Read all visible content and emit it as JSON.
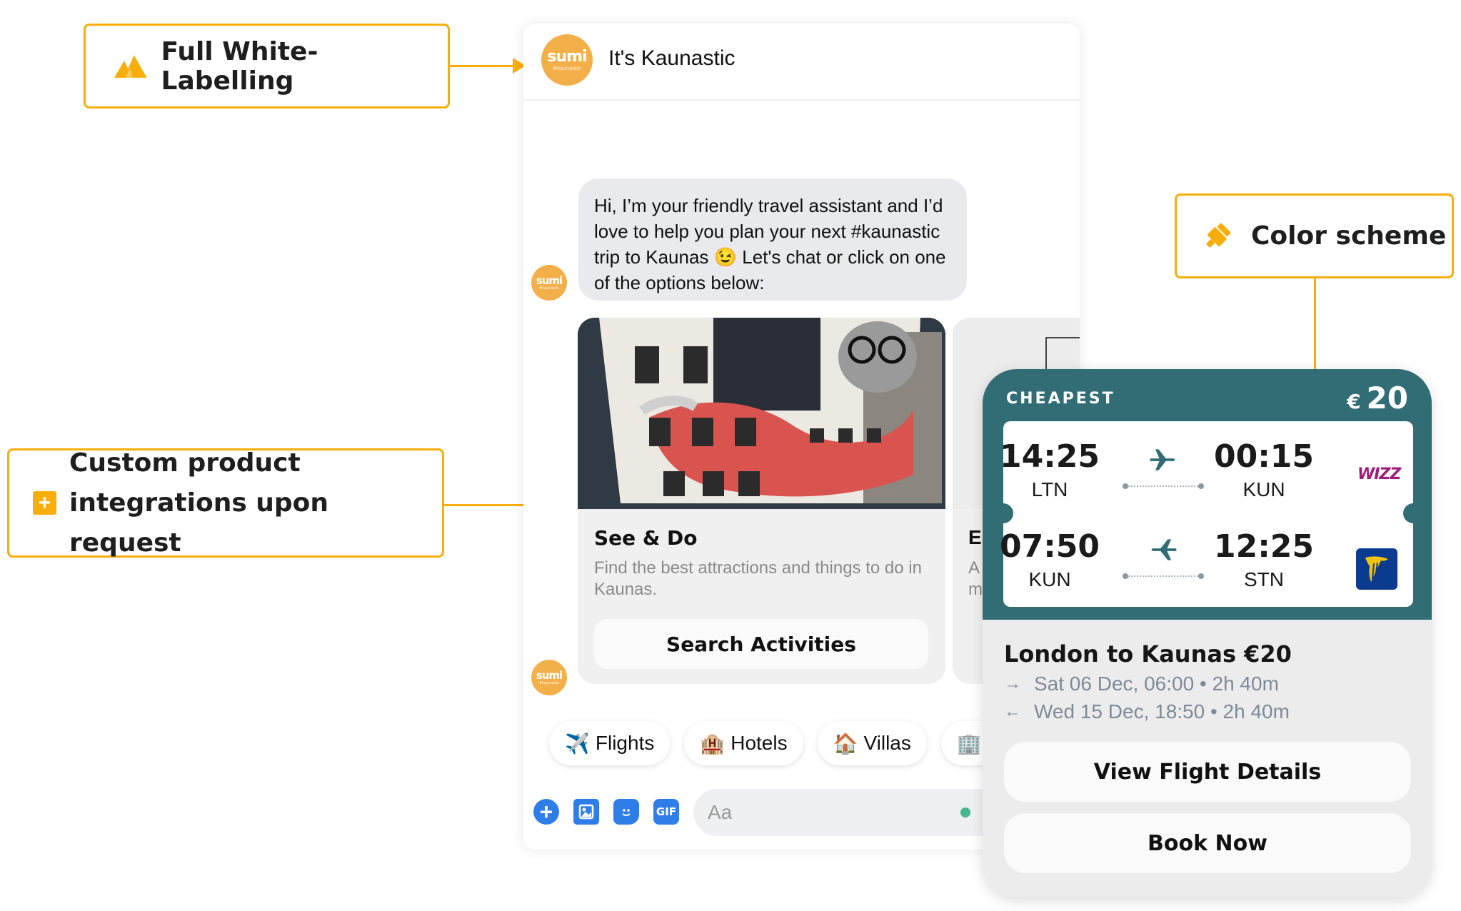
{
  "callouts": {
    "white_label": {
      "text": "Full White-Labelling",
      "icon": "mountain-logo-icon"
    },
    "custom_integrations": {
      "line1": "Custom product",
      "line2": "integrations upon request",
      "icon": "plus-square-icon"
    },
    "color_scheme": {
      "text": "Color scheme",
      "icon": "paint-brush-icon"
    }
  },
  "brand": {
    "accent": "#f7ad0a",
    "chat_avatar": "#f3b04a",
    "teal": "#326d76",
    "messenger_blue": "#2f7ee8"
  },
  "chat": {
    "title": "It's Kaunastic",
    "avatar": {
      "main": "sumi",
      "sub": "#kaunastic"
    },
    "message": "Hi, I’m your friendly travel assistant and I’d love to help you plan your next #kaunastic trip to Kaunas 😉 Let's chat or click on one of the options below:",
    "cards": [
      {
        "title": "See & Do",
        "description": "Find the best attractions and things to do in Kaunas.",
        "button": "Search Activities"
      },
      {
        "title": "E",
        "description_line1": "A",
        "description_line2": "m"
      }
    ],
    "quick_replies": [
      {
        "emoji": "✈️",
        "label": "Flights"
      },
      {
        "emoji": "🏨",
        "label": "Hotels"
      },
      {
        "emoji": "🏠",
        "label": "Villas"
      },
      {
        "emoji": "🏢",
        "label": ""
      }
    ],
    "composer": {
      "placeholder": "Aa",
      "icons": [
        "plus-icon",
        "photo-icon",
        "sticker-icon",
        "gif-icon"
      ],
      "gif_label": "GIF"
    }
  },
  "flight_card": {
    "label": "CHEAPEST",
    "currency": "€",
    "price": "20",
    "legs": [
      {
        "depart_time": "14:25",
        "depart_code": "LTN",
        "arrive_time": "00:15",
        "arrive_code": "KUN",
        "airline": "WIZZ"
      },
      {
        "depart_time": "07:50",
        "depart_code": "KUN",
        "arrive_time": "12:25",
        "arrive_code": "STN",
        "airline": "Ryanair"
      }
    ],
    "route": "London to Kaunas €20",
    "outbound": {
      "arrow": "→",
      "text": "Sat 06 Dec, 06:00 • 2h 40m"
    },
    "return": {
      "arrow": "←",
      "text": "Wed 15 Dec, 18:50 • 2h 40m"
    },
    "buttons": {
      "details": "View Flight Details",
      "book": "Book Now"
    }
  }
}
